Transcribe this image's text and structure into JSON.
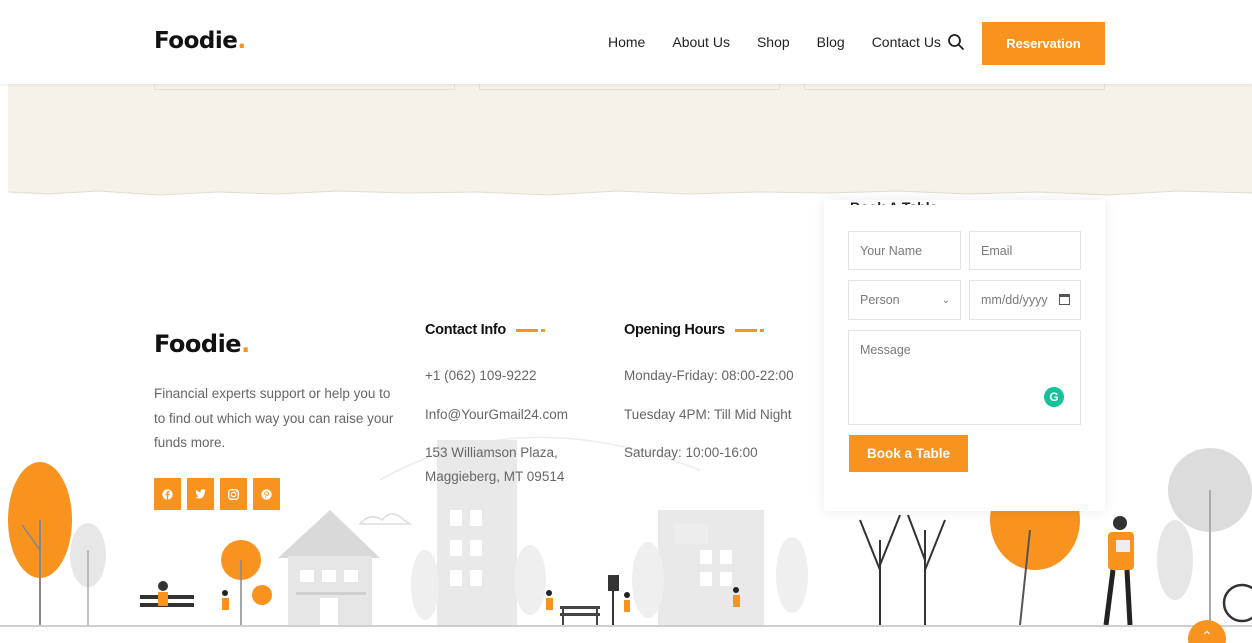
{
  "header": {
    "logo_text": "Foodie",
    "logo_dot": ".",
    "nav": [
      "Home",
      "About Us",
      "Shop",
      "Blog",
      "Contact Us"
    ],
    "search_icon": "search-icon",
    "reservation_label": "Reservation"
  },
  "booking": {
    "title": "Book A Table",
    "name_placeholder": "Your Name",
    "email_placeholder": "Email",
    "person_value": "Person",
    "date_placeholder": "mm/dd/yyyy",
    "message_placeholder": "Message",
    "grammarly_letter": "G",
    "submit_label": "Book a Table"
  },
  "footer": {
    "logo_text": "Foodie",
    "logo_dot": ".",
    "description": "Financial experts support or help you to to find out which way you can raise your funds more.",
    "socials": [
      "facebook-icon",
      "twitter-icon",
      "instagram-icon",
      "pinterest-icon"
    ],
    "contact": {
      "title": "Contact Info",
      "phone": "+1 (062) 109-9222",
      "email": "Info@YourGmail24.com",
      "address_line1": "153 Williamson Plaza,",
      "address_line2": "Maggieberg, MT 09514"
    },
    "hours": {
      "title": "Opening Hours",
      "line1": "Monday-Friday: 08:00-22:00",
      "line2": "Tuesday 4PM: Till Mid Night",
      "line3": "Saturday: 10:00-16:00"
    }
  },
  "colors": {
    "accent": "#f7931e",
    "band": "#f6f2ea",
    "text": "#666666"
  },
  "scroll_top_icon": "chevron-up-icon"
}
